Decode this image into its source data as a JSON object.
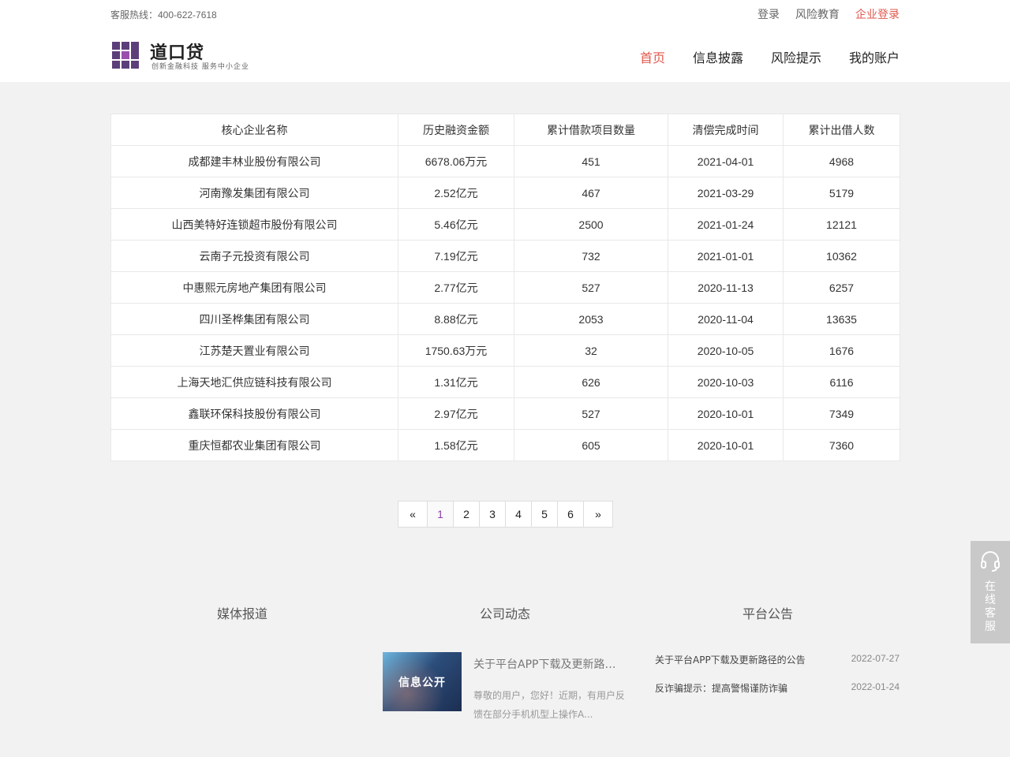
{
  "topbar": {
    "hotline": "客服热线：400-622-7618",
    "links": [
      "登录",
      "风险教育",
      "企业登录"
    ]
  },
  "logo": {
    "name": "道口贷",
    "slogan": "创新金融科技  服务中小企业"
  },
  "nav": {
    "items": [
      "首页",
      "信息披露",
      "风险提示",
      "我的账户"
    ],
    "active": "首页"
  },
  "table": {
    "headers": [
      "核心企业名称",
      "历史融资金额",
      "累计借款项目数量",
      "清偿完成时间",
      "累计出借人数"
    ],
    "rows": [
      [
        "成都建丰林业股份有限公司",
        "6678.06万元",
        "451",
        "2021-04-01",
        "4968"
      ],
      [
        "河南豫发集团有限公司",
        "2.52亿元",
        "467",
        "2021-03-29",
        "5179"
      ],
      [
        "山西美特好连锁超市股份有限公司",
        "5.46亿元",
        "2500",
        "2021-01-24",
        "12121"
      ],
      [
        "云南子元投资有限公司",
        "7.19亿元",
        "732",
        "2021-01-01",
        "10362"
      ],
      [
        "中惠熙元房地产集团有限公司",
        "2.77亿元",
        "527",
        "2020-11-13",
        "6257"
      ],
      [
        "四川圣桦集团有限公司",
        "8.88亿元",
        "2053",
        "2020-11-04",
        "13635"
      ],
      [
        "江苏楚天置业有限公司",
        "1750.63万元",
        "32",
        "2020-10-05",
        "1676"
      ],
      [
        "上海天地汇供应链科技有限公司",
        "1.31亿元",
        "626",
        "2020-10-03",
        "6116"
      ],
      [
        "鑫联环保科技股份有限公司",
        "2.97亿元",
        "527",
        "2020-10-01",
        "7349"
      ],
      [
        "重庆恒都农业集团有限公司",
        "1.58亿元",
        "605",
        "2020-10-01",
        "7360"
      ]
    ]
  },
  "pagination": {
    "prev": "«",
    "pages": [
      "1",
      "2",
      "3",
      "4",
      "5",
      "6"
    ],
    "next": "»",
    "current": "1"
  },
  "footer": {
    "media_title": "媒体报道",
    "company_title": "公司动态",
    "notice_title": "平台公告",
    "company_news": {
      "image_caption": "信息公开",
      "title": "关于平台APP下载及更新路…",
      "desc": "尊敬的用户，您好！近期，有用户反馈在部分手机机型上操作A..."
    },
    "notices": [
      {
        "title": "关于平台APP下载及更新路径的公告",
        "date": "2022-07-27"
      },
      {
        "title": "反诈骗提示：提高警惕谨防诈骗",
        "date": "2022-01-24"
      }
    ]
  },
  "service_widget": {
    "label": "在线客服",
    "icon": "headset-icon"
  },
  "colors": {
    "accent": "#e05a4f",
    "logo_purple": "#5c3f7a",
    "page_current": "#8b3fae",
    "widget_bg": "#c9c9c9"
  }
}
